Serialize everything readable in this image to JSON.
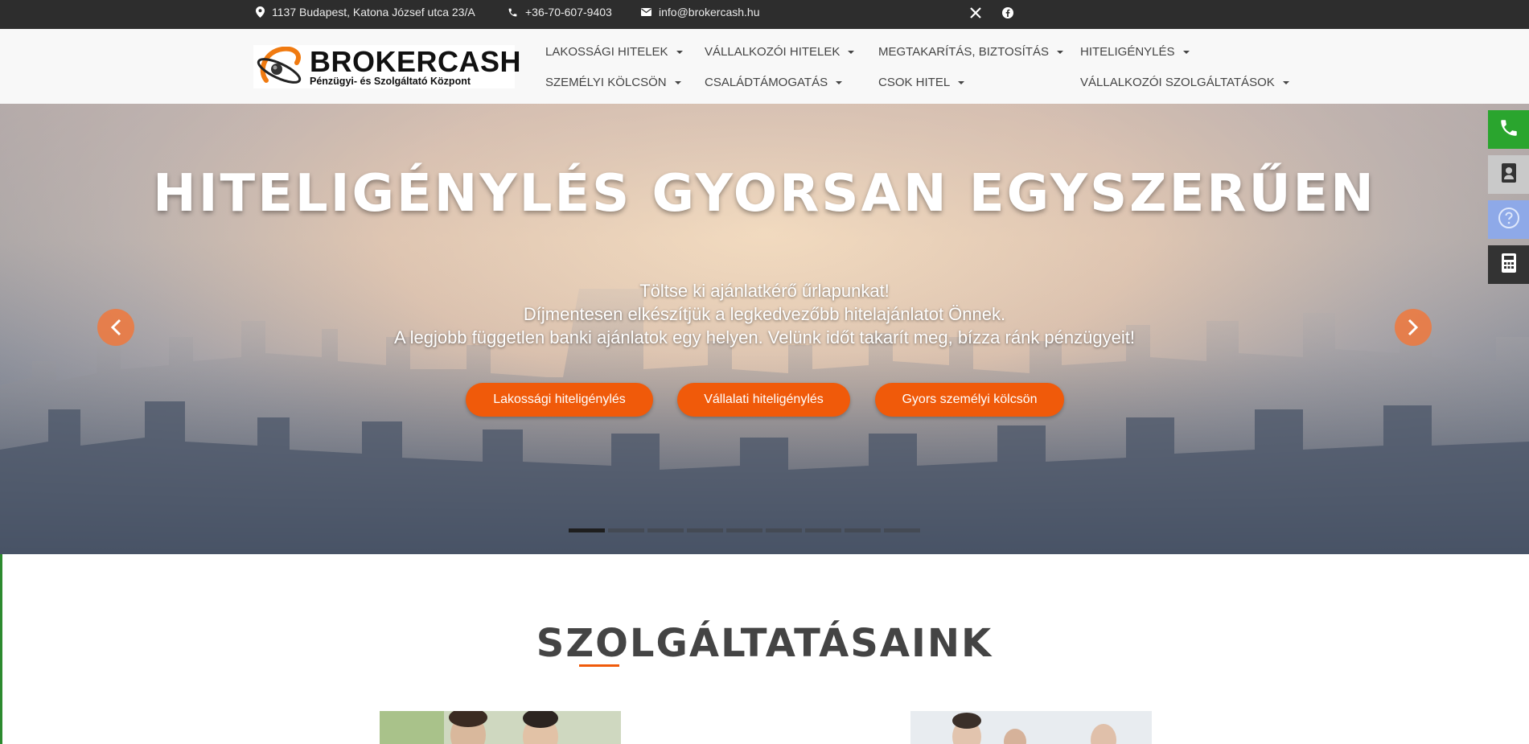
{
  "topbar": {
    "address": "1137 Budapest, Katona József utca 23/A",
    "phone": "+36-70-607-9403",
    "email": "info@brokercash.hu",
    "icons": [
      "map-pin-icon",
      "phone-icon",
      "envelope-icon",
      "x-twitter-icon",
      "facebook-icon"
    ]
  },
  "logo": {
    "brand": "BROKERCASH",
    "tagline": "Pénzügyi- és Szolgáltató Központ"
  },
  "nav": {
    "items": [
      "LAKOSSÁGI HITELEK",
      "VÁLLALKOZÓI HITELEK",
      "MEGTAKARÍTÁS, BIZTOSÍTÁS",
      "HITELIGÉNYLÉS",
      "SZEMÉLYI KÖLCSÖN",
      "CSALÁDTÁMOGATÁS",
      "CSOK HITEL",
      "VÁLLALKOZÓI SZOLGÁLTATÁSOK"
    ]
  },
  "hero": {
    "title": "HITELIGÉNYLÉS GYORSAN EGYSZERŰEN",
    "line1": "Töltse ki ajánlatkérő űrlapunkat!",
    "line2": "Díjmentesen elkészítjük a legkedvezőbb hitelajánlatot Önnek.",
    "line3": "A legjobb független banki ajánlatok egy helyen. Velünk időt takarít meg, bízza ránk pénzügyeit!",
    "buttons": [
      "Lakossági hiteligénylés",
      "Vállalati hiteligénylés",
      "Gyors személyi kölcsön"
    ],
    "slide_count": 9,
    "active_slide": 1
  },
  "side_buttons": [
    "phone-icon",
    "contact-card-icon",
    "question-icon",
    "calculator-icon"
  ],
  "colors": {
    "accent": "#f05a0a",
    "topbar": "#2d2d2d",
    "side_green": "#2aa52e",
    "side_gray": "#c9c9c9",
    "side_blue": "#8ea9e8",
    "side_dark": "#333333"
  },
  "services": {
    "title": "SZOLGÁLTATÁSAINK"
  }
}
